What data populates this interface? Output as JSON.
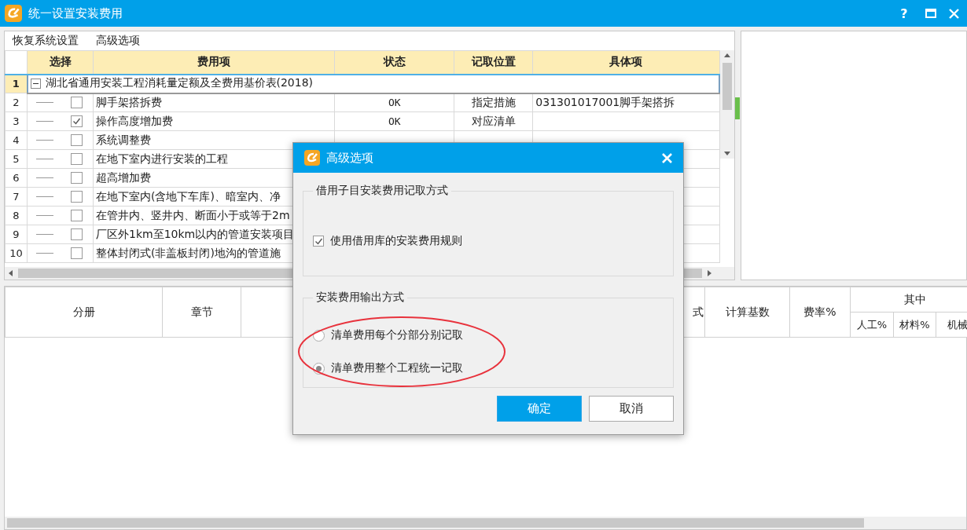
{
  "window": {
    "title": "统一设置安装费用",
    "help": "?"
  },
  "toolbar": [
    "恢复系统设置",
    "高级选项"
  ],
  "grid": {
    "columns": [
      "选择",
      "费用项",
      "状态",
      "记取位置",
      "具体项"
    ],
    "group": {
      "number": "1",
      "label": "湖北省通用安装工程消耗量定额及全费用基价表(2018)",
      "expanded": true
    },
    "rows": [
      {
        "number": "2",
        "checked": false,
        "item": "脚手架搭拆费",
        "status": "OK",
        "position": "指定措施",
        "detail": "031301017001脚手架搭拆"
      },
      {
        "number": "3",
        "checked": true,
        "item": "操作高度增加费",
        "status": "OK",
        "position": "对应清单",
        "detail": ""
      },
      {
        "number": "4",
        "checked": false,
        "item": "系统调整费",
        "status": "",
        "position": "",
        "detail": ""
      },
      {
        "number": "5",
        "checked": false,
        "item": "在地下室内进行安装的工程",
        "status": "",
        "position": "",
        "detail": ""
      },
      {
        "number": "6",
        "checked": false,
        "item": "超高增加费",
        "status": "",
        "position": "",
        "detail": ""
      },
      {
        "number": "7",
        "checked": false,
        "item": "在地下室内(含地下车库)、暗室内、净",
        "status": "",
        "position": "",
        "detail": ""
      },
      {
        "number": "8",
        "checked": false,
        "item": "在管井内、竖井内、断面小于或等于2m",
        "status": "",
        "position": "",
        "detail": ""
      },
      {
        "number": "9",
        "checked": false,
        "item": "厂区外1km至10km以内的管道安装项目",
        "status": "",
        "position": "",
        "detail": ""
      },
      {
        "number": "10",
        "checked": false,
        "item": "整体封闭式(非盖板封闭)地沟的管道施",
        "status": "",
        "position": "",
        "detail": ""
      }
    ]
  },
  "lower_table": {
    "columns": [
      {
        "label": "分册"
      },
      {
        "label": "章节"
      },
      {
        "label": "式"
      },
      {
        "label": "计算基数"
      },
      {
        "label": "费率%"
      },
      {
        "label": "其中",
        "children": [
          "人工%",
          "材料%",
          "机械"
        ]
      }
    ]
  },
  "dialog": {
    "title": "高级选项",
    "groups": [
      {
        "title": "借用子目安装费用记取方式",
        "options": [
          {
            "kind": "checkbox",
            "label": "使用借用库的安装费用规则",
            "checked": true
          }
        ]
      },
      {
        "title": "安装费用输出方式",
        "options": [
          {
            "kind": "radio",
            "label": "清单费用每个分部分别记取",
            "selected": false
          },
          {
            "kind": "radio",
            "label": "清单费用整个工程统一记取",
            "selected": true
          }
        ]
      }
    ],
    "buttons": [
      {
        "kind": "primary",
        "label": "确定"
      },
      {
        "kind": "secondary",
        "label": "取消"
      }
    ]
  }
}
